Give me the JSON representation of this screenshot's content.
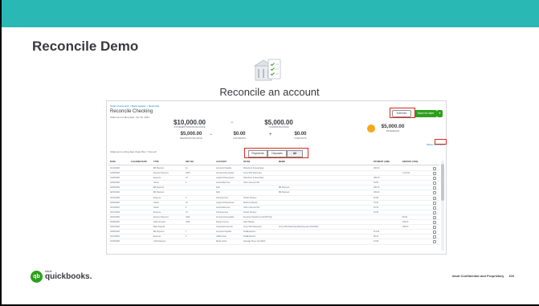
{
  "slide": {
    "title": "Reconcile Demo",
    "hero_icon": "reconcile-document-icon",
    "hero_title": "Reconcile an account",
    "accent_color": "#2ab8b4",
    "highlight_color": "#d52b1e"
  },
  "reconcile": {
    "breadcrumb": "Chart of accounts > Bank register > Reconcile",
    "account_title": "Reconcile Checking",
    "statement_line": "Statement ending date: Apr 30, 2020",
    "statement_ending_balance": {
      "value": "$10,000.00",
      "label": "Statement ending balance"
    },
    "cleared_balance": {
      "value": "$5,000.00",
      "label": "Cleared balance"
    },
    "beginning_balance": {
      "value": "$5,000.00",
      "label": "Beginning balance"
    },
    "payments": {
      "value": "$0.00",
      "label": "0 payments"
    },
    "deposits": {
      "value": "$0.00",
      "label": "0 deposits"
    },
    "difference": {
      "value": "$5,000.00",
      "label": "Difference"
    },
    "minus_symbol": "−",
    "plus_symbol": "+",
    "buttons": {
      "edit_info": "Edit info",
      "save_for_later": "Save for later",
      "dropdown": "▾"
    },
    "filter_text": "Statement ending date    Clear filter / View all",
    "help_link": "Show me around",
    "segments": [
      "Payments",
      "Deposits",
      "All"
    ],
    "active_segment": "All",
    "columns": [
      "DATE",
      "CLEARED DATE",
      "TYPE",
      "REF NO.",
      "ACCOUNT",
      "PAYEE",
      "MEMO",
      "PAYMENT (USD)",
      "DEPOSIT (USD)"
    ],
    "rows": [
      {
        "date": "01/14/2020",
        "type": "Bill Payment",
        "ref": "12",
        "account": "Accounts Payable",
        "payee": "Robertson & Associates",
        "memo": "",
        "payment": "300.00",
        "deposit": ""
      },
      {
        "date": "01/05/2020",
        "type": "Receive Payment",
        "ref": "1005",
        "account": "Accounts Receivable",
        "payee": "Amy's Bird Sanctuary",
        "memo": "",
        "payment": "",
        "deposit": "1,115.00"
      },
      {
        "date": "01/26/2020",
        "type": "Expense",
        "ref": "10",
        "account": "Legal & Professional",
        "payee": "Robertson & Associates",
        "memo": "",
        "payment": "250.00",
        "deposit": ""
      },
      {
        "date": "02/09/2020",
        "type": "Check",
        "ref": "6",
        "account": "Automobile:Fuel",
        "payee": "Chin's Gas and Oil",
        "memo": "",
        "payment": "54.55",
        "deposit": ""
      },
      {
        "date": "02/09/2020",
        "type": "Bill Payment",
        "ref": "",
        "account": "Split",
        "payee": "",
        "memo": "Bill Payment",
        "payment": "200.00",
        "deposit": ""
      },
      {
        "date": "02/16/2020",
        "type": "Bill Payment",
        "ref": "",
        "account": "Split",
        "payee": "",
        "memo": "Bill Payment",
        "payment": "150.00",
        "deposit": ""
      },
      {
        "date": "02/21/2020",
        "type": "Expense",
        "ref": "8",
        "account": "Job Expenses",
        "payee": "Tania's Nursery",
        "memo": "",
        "payment": "46.98",
        "deposit": ""
      },
      {
        "date": "03/03/2020",
        "type": "Check",
        "ref": "15",
        "account": "Legal & Professional",
        "payee": "Books by Bessie",
        "memo": "",
        "payment": "75.00",
        "deposit": ""
      },
      {
        "date": "03/11/2020",
        "type": "Check",
        "ref": "9",
        "account": "Automobile:Fuel",
        "payee": "Chin's Gas and Oil",
        "memo": "",
        "payment": "63.15",
        "deposit": ""
      },
      {
        "date": "03/17/2020",
        "type": "Expense",
        "ref": "13",
        "account": "Job Expenses",
        "payee": "Tania's Nursery",
        "memo": "",
        "payment": "23.50",
        "deposit": ""
      },
      {
        "date": "03/24/2020",
        "type": "Receive Payment",
        "ref": "1006",
        "account": "Accounts Receivable",
        "payee": "Freeman Sporting Goods:55 Twin",
        "memo": "",
        "payment": "",
        "deposit": "86.40"
      },
      {
        "date": "03/28/2020",
        "type": "Sales Receipt",
        "ref": "1008",
        "account": "Design income",
        "payee": "Kate Whelan",
        "memo": "",
        "payment": "",
        "deposit": "225.00"
      },
      {
        "date": "04/01/2020",
        "type": "Bank Deposit",
        "ref": "",
        "account": "Undeposited Funds",
        "payee": "Amy's Bird Sanctuary",
        "memo": "Amy's Bird Sanctuary Bank Deposit 4/01/2020",
        "payment": "",
        "deposit": "108.00"
      },
      {
        "date": "04/05/2020",
        "type": "Bill Payment",
        "ref": "7",
        "account": "Accounts Payable",
        "payee": "PG&E Electric",
        "memo": "",
        "payment": "114.09",
        "deposit": ""
      },
      {
        "date": "04/11/2020",
        "type": "Expense",
        "ref": "4",
        "account": "Utilities:Gas",
        "payee": "PG&E Electric",
        "memo": "",
        "payment": "86.44",
        "deposit": ""
      },
      {
        "date": "04/19/2020",
        "type": "Cash Expense",
        "ref": "",
        "account": "Meals & Ent.",
        "payee": "Squeaky Kleen Car Wash",
        "memo": "",
        "payment": "19.99",
        "deposit": ""
      }
    ]
  },
  "footer": {
    "logo_intuit": "intuit",
    "logo_word": "quickbooks.",
    "logo_mark": "qb",
    "confidential": "Intuit Confidential and Proprietary",
    "page_number": "103"
  }
}
